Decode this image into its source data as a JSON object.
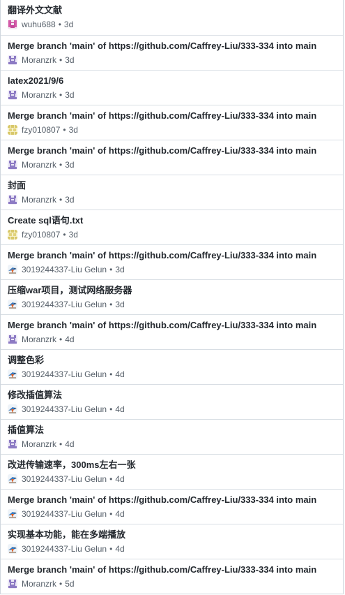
{
  "separator": "•",
  "commits": [
    {
      "message": "翻译外文文献",
      "author": "wuhu688",
      "time": "3d",
      "avatar": "pink-avatar-icon"
    },
    {
      "message": "Merge branch 'main' of https://github.com/Caffrey-Liu/333-334 into main",
      "author": "Moranzrk",
      "time": "3d",
      "avatar": "purple-avatar-icon"
    },
    {
      "message": "latex2021/9/6",
      "author": "Moranzrk",
      "time": "3d",
      "avatar": "purple-avatar-icon"
    },
    {
      "message": "Merge branch 'main' of https://github.com/Caffrey-Liu/333-334 into main",
      "author": "fzy010807",
      "time": "3d",
      "avatar": "yellow-avatar-icon"
    },
    {
      "message": "Merge branch 'main' of https://github.com/Caffrey-Liu/333-334 into main",
      "author": "Moranzrk",
      "time": "3d",
      "avatar": "purple-avatar-icon"
    },
    {
      "message": "封面",
      "author": "Moranzrk",
      "time": "3d",
      "avatar": "purple-avatar-icon"
    },
    {
      "message": "Create sql语句.txt",
      "author": "fzy010807",
      "time": "3d",
      "avatar": "yellow-avatar-icon"
    },
    {
      "message": "Merge branch 'main' of https://github.com/Caffrey-Liu/333-334 into main",
      "author": "3019244337-Liu Gelun",
      "time": "3d",
      "avatar": "bird-avatar-icon"
    },
    {
      "message": "压缩war项目，测试网络服务器",
      "author": "3019244337-Liu Gelun",
      "time": "3d",
      "avatar": "bird-avatar-icon"
    },
    {
      "message": "Merge branch 'main' of https://github.com/Caffrey-Liu/333-334 into main",
      "author": "Moranzrk",
      "time": "4d",
      "avatar": "purple-avatar-icon"
    },
    {
      "message": "调整色彩",
      "author": "3019244337-Liu Gelun",
      "time": "4d",
      "avatar": "bird-avatar-icon"
    },
    {
      "message": "修改插值算法",
      "author": "3019244337-Liu Gelun",
      "time": "4d",
      "avatar": "bird-avatar-icon"
    },
    {
      "message": "插值算法",
      "author": "Moranzrk",
      "time": "4d",
      "avatar": "purple-avatar-icon"
    },
    {
      "message": "改进传输速率，300ms左右一张",
      "author": "3019244337-Liu Gelun",
      "time": "4d",
      "avatar": "bird-avatar-icon"
    },
    {
      "message": "Merge branch 'main' of https://github.com/Caffrey-Liu/333-334 into main",
      "author": "3019244337-Liu Gelun",
      "time": "4d",
      "avatar": "bird-avatar-icon"
    },
    {
      "message": "实现基本功能，能在多端播放",
      "author": "3019244337-Liu Gelun",
      "time": "4d",
      "avatar": "bird-avatar-icon"
    },
    {
      "message": "Merge branch 'main' of https://github.com/Caffrey-Liu/333-334 into main",
      "author": "Moranzrk",
      "time": "5d",
      "avatar": "purple-avatar-icon"
    }
  ]
}
